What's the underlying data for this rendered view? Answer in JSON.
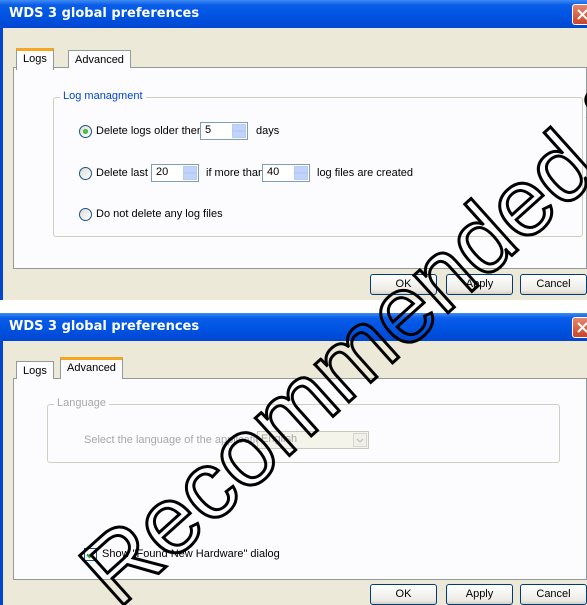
{
  "dialog1": {
    "title": "WDS 3 global preferences",
    "tabs": [
      "Logs",
      "Advanced"
    ],
    "group_label": "Log managment",
    "opt1": {
      "pre": "Delete logs older then",
      "value": "5",
      "post": "days"
    },
    "opt2": {
      "pre": "Delete last",
      "value1": "20",
      "mid": "if more than",
      "value2": "40",
      "post": "log files are created"
    },
    "opt3": {
      "label": "Do not delete any log files"
    },
    "selected_option": 1,
    "buttons": {
      "ok": "OK",
      "apply": "Apply",
      "cancel": "Cancel"
    }
  },
  "dialog2": {
    "title": "WDS 3 global preferences",
    "tabs": [
      "Logs",
      "Advanced"
    ],
    "group_label": "Language",
    "language_prompt": "Select the language of the application",
    "language_value": "English",
    "checkbox_label": "Show \"Found New Hardware\" dialog",
    "checkbox_checked": true,
    "buttons": {
      "ok": "OK",
      "apply": "Apply",
      "cancel": "Cancel"
    }
  },
  "watermark": {
    "text": "Recommended for No",
    "color": "#000000"
  }
}
